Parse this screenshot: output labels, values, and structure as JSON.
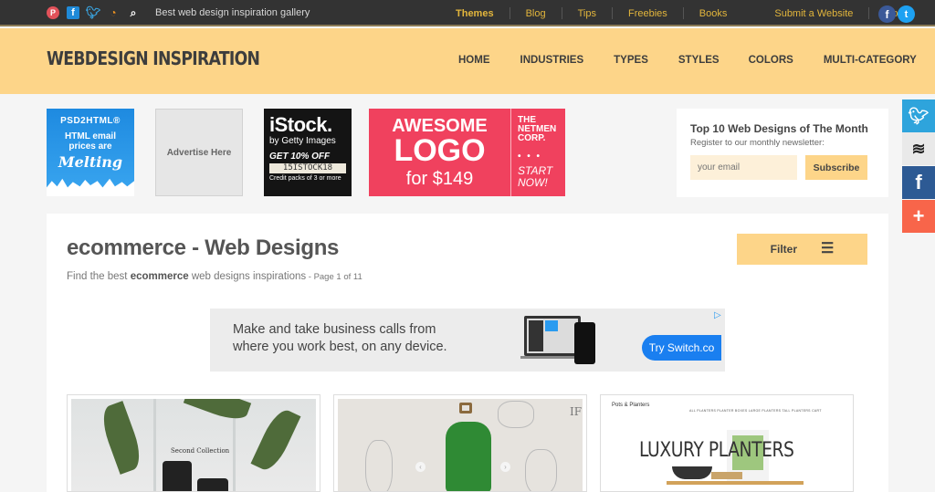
{
  "topbar": {
    "social_icons": [
      "pinterest-icon",
      "facebook-icon",
      "twitter-icon",
      "rss-icon",
      "search-icon"
    ],
    "tagline": "Best web design inspiration gallery",
    "nav": [
      {
        "label": "Themes",
        "active": true
      },
      {
        "label": "Blog"
      },
      {
        "label": "Tips"
      },
      {
        "label": "Freebies"
      },
      {
        "label": "Books"
      },
      {
        "label": "Submit a Website"
      },
      {
        "label": "Conta"
      }
    ],
    "share_icons": [
      "facebook-icon",
      "twitter-icon"
    ]
  },
  "header": {
    "logo": "WEBDESIGN INSPIRATION",
    "nav": [
      "HOME",
      "INDUSTRIES",
      "TYPES",
      "STYLES",
      "COLORS",
      "MULTI-CATEGORY"
    ]
  },
  "ads": {
    "psd2html": {
      "brand": "PSD2HTML®",
      "line1": "HTML email",
      "line2": "prices are",
      "line3": "Melting"
    },
    "placeholder": "Advertise Here",
    "istock": {
      "brand": "iStock.",
      "sub": "by Getty Images",
      "offer": "GET 10% OFF",
      "code": "15ISTOCK18",
      "note": "Credit packs of 3 or more"
    },
    "logo_ad": {
      "line1": "AWESOME",
      "line2": "LOGO",
      "line3": "for $149",
      "brand1": "THE",
      "brand2": "NETMEN",
      "brand3": "CORP.",
      "dots": "• • •",
      "cta1": "START",
      "cta2": "NOW!"
    }
  },
  "newsletter": {
    "title": "Top 10 Web Designs of The Month",
    "subtitle": "Register to our monthly newsletter:",
    "email_placeholder": "your email",
    "subscribe": "Subscribe"
  },
  "side_share": [
    "twitter-icon",
    "buffer-icon",
    "facebook-icon",
    "plus-icon"
  ],
  "page": {
    "title": "ecommerce - Web Designs",
    "subtitle_prefix": "Find the best ",
    "subtitle_keyword": "ecommerce",
    "subtitle_suffix": " web designs inspirations",
    "page_info": " - Page 1 of 11",
    "filter_label": "Filter"
  },
  "banner": {
    "line1": "Make and take business calls from",
    "line2": "where you work best, on any device.",
    "cta": "Try Switch.co",
    "ad_icon": "▷"
  },
  "cards": [
    {
      "caption": "Second Collection"
    },
    {
      "caption": "IF"
    },
    {
      "caption": "LUXURY PLANTERS",
      "brand": "Pots & Planters",
      "links": "ALL PLANTERS   PLANTER BOXES   LARGE PLANTERS   TALL PLANTERS   CART"
    }
  ],
  "colors": {
    "topbar_bg": "#333333",
    "accent": "#fdd589",
    "nav_gold": "#e3b63c",
    "cta_blue": "#1a7ff0"
  }
}
